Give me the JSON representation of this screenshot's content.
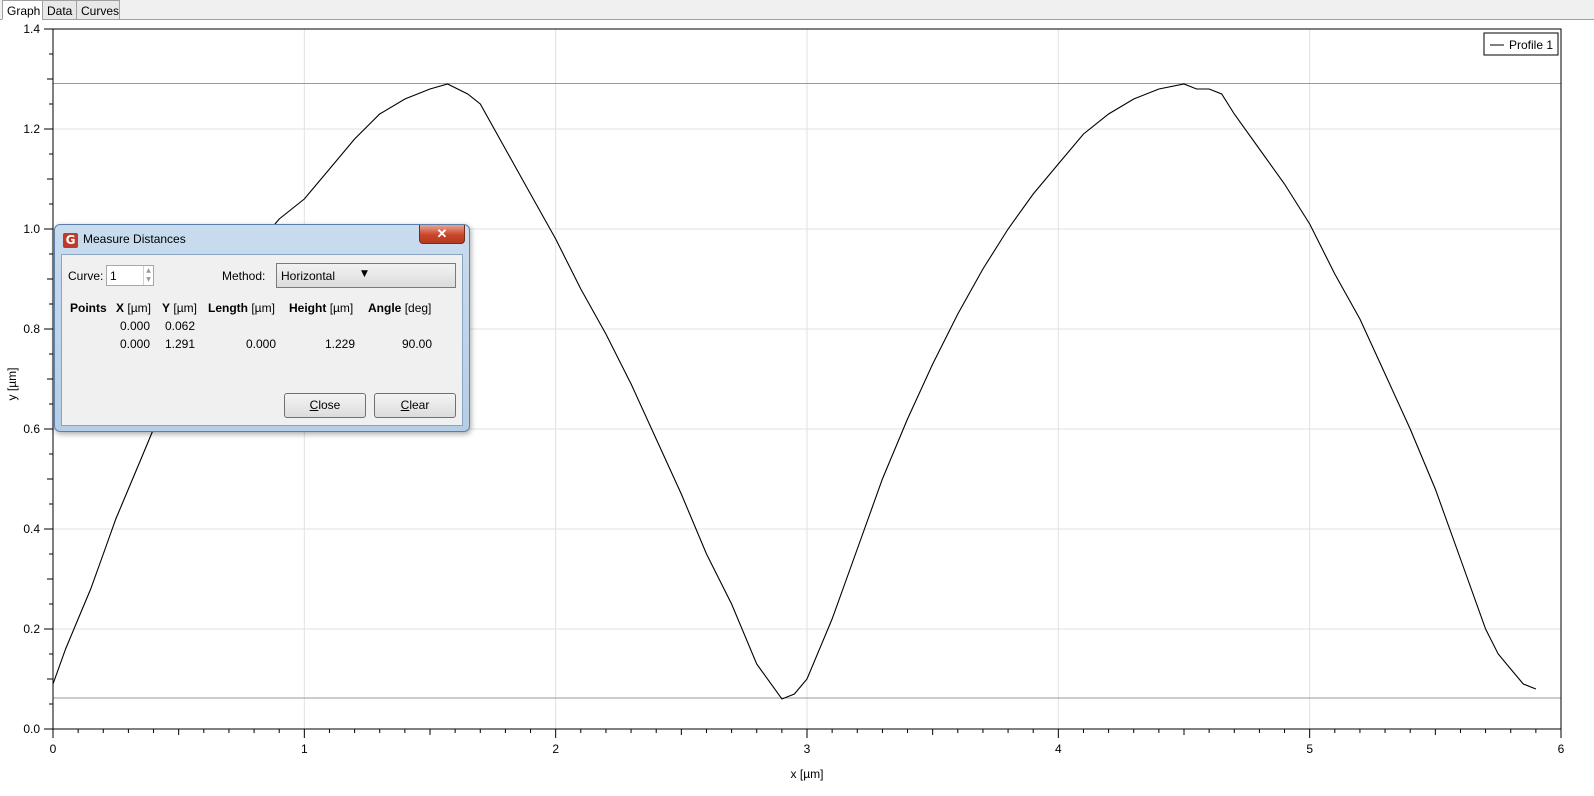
{
  "tabs": [
    {
      "label": "Graph",
      "active": true
    },
    {
      "label": "Data",
      "active": false
    },
    {
      "label": "Curves",
      "active": false
    }
  ],
  "legend": {
    "entry": "Profile 1",
    "placement": "top-right"
  },
  "chart_data": {
    "type": "line",
    "xlabel": "x [µm]",
    "ylabel": "y [µm]",
    "xlim": [
      0,
      6
    ],
    "ylim": [
      0,
      1.4
    ],
    "x_ticks": [
      "0",
      "1",
      "2",
      "3",
      "4",
      "5",
      "6"
    ],
    "y_ticks": [
      "0.0",
      "0.2",
      "0.4",
      "0.6",
      "0.8",
      "1.0",
      "1.2",
      "1.4"
    ],
    "grid": true,
    "horizontal_markers": [
      1.291,
      0.062
    ],
    "series": [
      {
        "name": "Profile 1",
        "color": "#000000",
        "x": [
          0.0,
          0.05,
          0.1,
          0.15,
          0.2,
          0.25,
          0.3,
          0.35,
          0.4,
          0.45,
          0.5,
          0.6,
          0.7,
          0.8,
          0.9,
          1.0,
          1.1,
          1.2,
          1.3,
          1.4,
          1.5,
          1.57,
          1.65,
          1.7,
          1.8,
          1.9,
          2.0,
          2.1,
          2.2,
          2.3,
          2.4,
          2.5,
          2.6,
          2.7,
          2.8,
          2.9,
          2.95,
          3.0,
          3.1,
          3.2,
          3.3,
          3.4,
          3.5,
          3.6,
          3.7,
          3.8,
          3.9,
          4.0,
          4.1,
          4.2,
          4.3,
          4.4,
          4.5,
          4.55,
          4.6,
          4.65,
          4.7,
          4.8,
          4.9,
          5.0,
          5.1,
          5.2,
          5.3,
          5.4,
          5.5,
          5.6,
          5.7,
          5.75,
          5.8,
          5.85,
          5.9
        ],
        "y": [
          0.09,
          0.16,
          0.22,
          0.28,
          0.35,
          0.42,
          0.48,
          0.54,
          0.6,
          0.66,
          0.7,
          0.8,
          0.88,
          0.96,
          1.02,
          1.06,
          1.12,
          1.18,
          1.23,
          1.26,
          1.28,
          1.29,
          1.27,
          1.25,
          1.16,
          1.07,
          0.98,
          0.88,
          0.79,
          0.69,
          0.58,
          0.47,
          0.35,
          0.25,
          0.13,
          0.06,
          0.07,
          0.1,
          0.22,
          0.36,
          0.5,
          0.62,
          0.73,
          0.83,
          0.92,
          1.0,
          1.07,
          1.13,
          1.19,
          1.23,
          1.26,
          1.28,
          1.29,
          1.28,
          1.28,
          1.27,
          1.23,
          1.16,
          1.09,
          1.01,
          0.91,
          0.82,
          0.71,
          0.6,
          0.48,
          0.34,
          0.2,
          0.15,
          0.12,
          0.09,
          0.08
        ]
      }
    ]
  },
  "dialog": {
    "title": "Measure Distances",
    "icon_glyph": "G",
    "close_glyph": "✕",
    "curve_label": "Curve:",
    "curve_value": "1",
    "method_label": "Method:",
    "method_value": "Horizontal",
    "columns": [
      {
        "name": "Points",
        "unit": ""
      },
      {
        "name": "X",
        "unit": "[µm]"
      },
      {
        "name": "Y",
        "unit": "[µm]"
      },
      {
        "name": "Length",
        "unit": "[µm]"
      },
      {
        "name": "Height",
        "unit": "[µm]"
      },
      {
        "name": "Angle",
        "unit": "[deg]"
      }
    ],
    "rows": [
      {
        "x": "0.000",
        "y": "0.062",
        "length": "",
        "height": "",
        "angle": ""
      },
      {
        "x": "0.000",
        "y": "1.291",
        "length": "0.000",
        "height": "1.229",
        "angle": "90.00"
      }
    ],
    "close_button": {
      "accel": "C",
      "rest": "lose"
    },
    "clear_button": {
      "accel": "C",
      "rest": "lear"
    }
  }
}
